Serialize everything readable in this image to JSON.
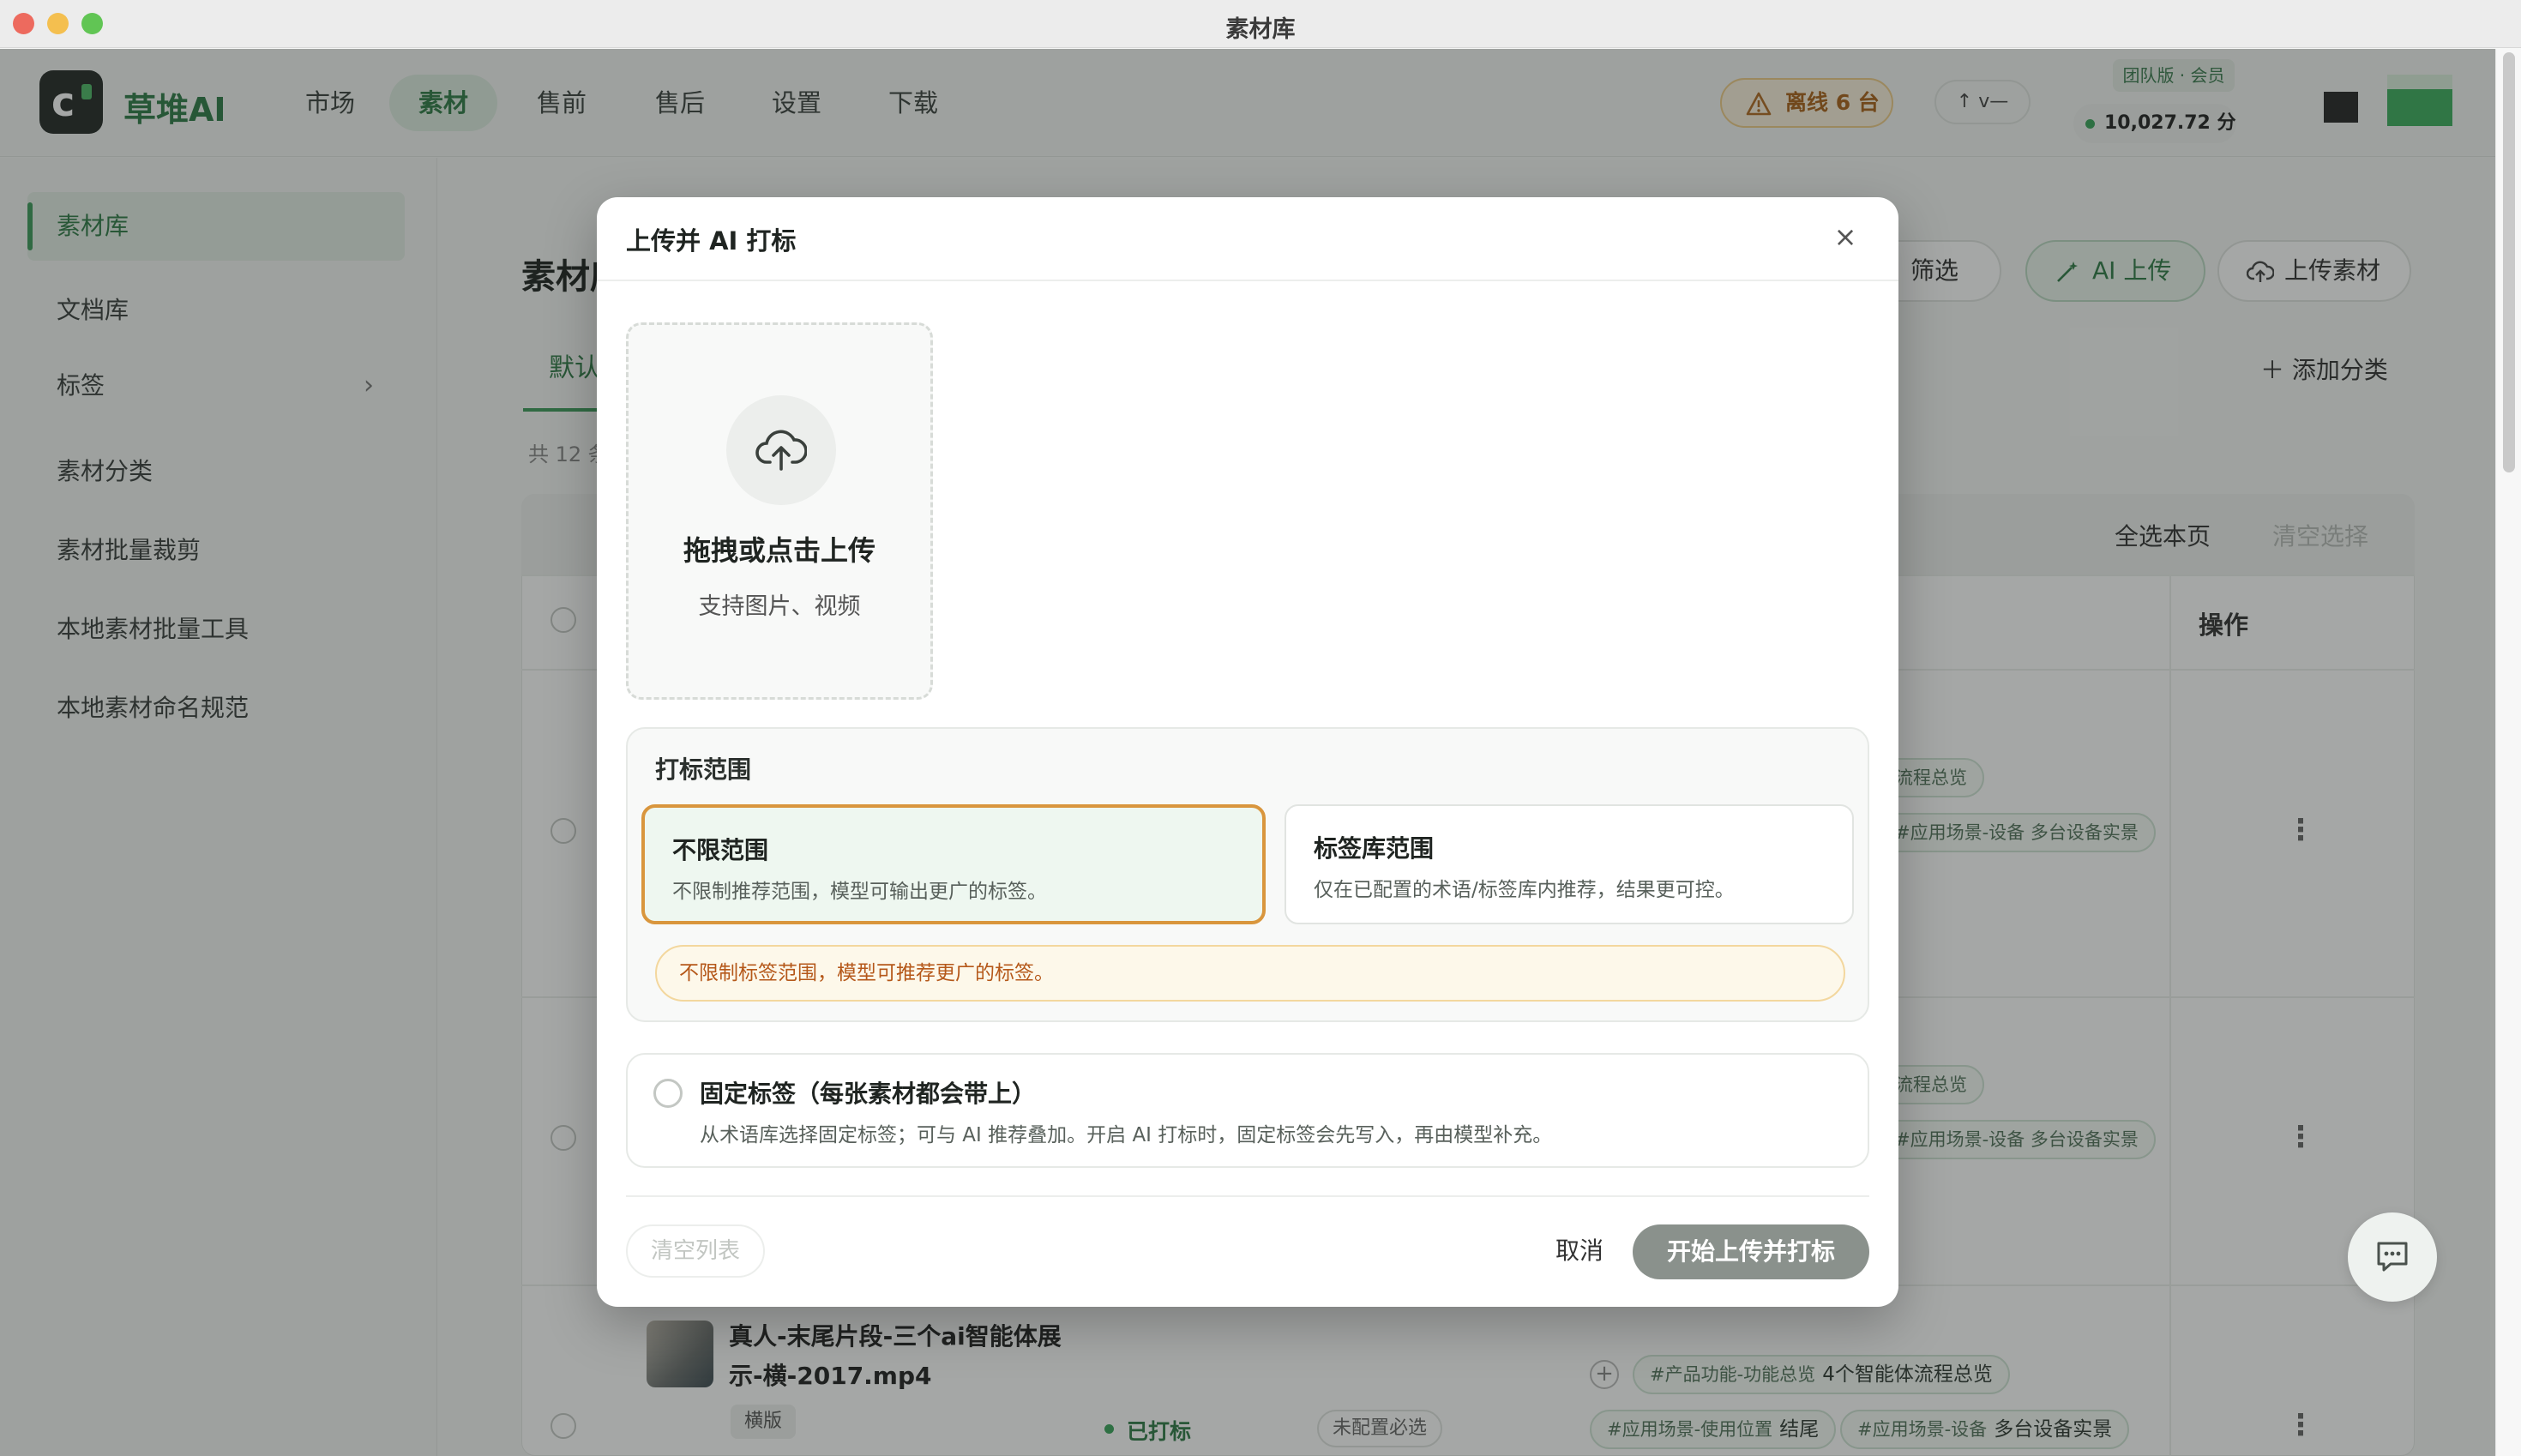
{
  "window": {
    "title": "素材库"
  },
  "header": {
    "brand": "草堆AI",
    "nav": [
      "市场",
      "素材",
      "售前",
      "售后",
      "设置",
      "下载"
    ],
    "active_nav": "素材",
    "offline_badge": "离线 6 台",
    "version_label": "v—",
    "team_badge": "团队版 · 会员",
    "points": "10,027.72 分"
  },
  "sidebar": {
    "items": [
      "素材库",
      "文档库",
      "标签",
      "素材分类",
      "素材批量裁剪",
      "本地素材批量工具",
      "本地素材命名规范"
    ],
    "active_item": "素材库"
  },
  "main": {
    "title": "素材库",
    "tab_default": "默认",
    "count_text": "共 12 条",
    "filter_button": "筛选",
    "ai_upload_button": "AI 上传",
    "upload_button": "上传素材",
    "add_category": "添加分类",
    "select_all_page": "全选本页",
    "clear_selection": "清空选择",
    "ops_header": "操作",
    "rows": [
      {
        "tags": [
          "流程总览",
          "#应用场景-设备 多台设备实景"
        ]
      },
      {
        "tags": [
          "流程总览",
          "#应用场景-设备 多台设备实景"
        ]
      },
      {
        "name": "真人-末尾片段-三个ai智能体展示-横-2017.mp4",
        "orientation": "横版",
        "status": "已打标",
        "required": "未配置必选",
        "tags": [
          {
            "cat": "#产品功能-功能总览",
            "val": "4个智能体流程总览"
          },
          {
            "cat": "#应用场景-使用位置",
            "val": "结尾"
          },
          {
            "cat": "#应用场景-设备",
            "val": "多台设备实景"
          }
        ]
      }
    ]
  },
  "modal": {
    "title": "上传并 AI 打标",
    "dropzone_title": "拖拽或点击上传",
    "dropzone_sub": "支持图片、视频",
    "scope_title": "打标范围",
    "scope_options": [
      {
        "title": "不限范围",
        "desc": "不限制推荐范围，模型可输出更广的标签。",
        "selected": true
      },
      {
        "title": "标签库范围",
        "desc": "仅在已配置的术语/标签库内推荐，结果更可控。",
        "selected": false
      }
    ],
    "scope_note": "不限制标签范围，模型可推荐更广的标签。",
    "fixed_title": "固定标签（每张素材都会带上）",
    "fixed_desc": "从术语库选择固定标签；可与 AI 推荐叠加。开启 AI 打标时，固定标签会先写入，再由模型补充。",
    "clear_list": "清空列表",
    "cancel": "取消",
    "start": "开始上传并打标"
  },
  "colors": {
    "brand_green": "#2f7a46",
    "selected_border": "#d9963d",
    "note_text": "#b5581a",
    "start_button_disabled": "#8a918c"
  }
}
